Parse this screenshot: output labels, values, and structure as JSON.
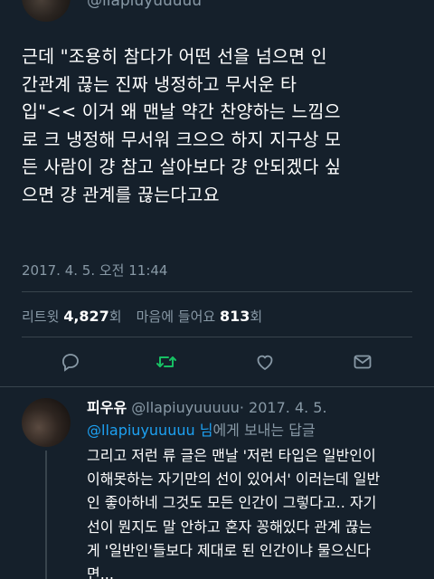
{
  "header": {
    "handle": "@llapiuyuuuuu"
  },
  "tweet": {
    "lines": [
      "근데 \"조용히 참다가 어떤 선을 넘으면 인",
      "간관계 끊는 진짜 냉정하고 무서운 타",
      "입\"<< 이거 왜 맨날 약간 찬양하는 느낌으",
      "로 크 냉정해 무서워 크으으 하지 지구상 모",
      "든 사람이 걍 참고 살아보다 걍 안되겠다 싶",
      "으면 걍 관계를 끊는다고요"
    ],
    "timestamp": "2017. 4. 5. 오전 11:44",
    "stats": {
      "retweet_label": "리트윗",
      "retweet_count": "4,827",
      "retweet_unit": "회",
      "like_label": "마음에 들어요",
      "like_count": "813",
      "like_unit": "회"
    }
  },
  "actions": {
    "reply_icon": "reply-icon",
    "retweet_icon": "retweet-icon",
    "like_icon": "heart-icon",
    "dm_icon": "envelope-icon",
    "retweet_color": "#17bf63",
    "icon_color": "#8899a6"
  },
  "reply": {
    "name": "피우유",
    "handle": "@llapiuyuuuuu",
    "date": "· 2017. 4. 5.",
    "mention": "@llapiuyuuuuu",
    "reply_to_suffix_1": "님",
    "reply_to_suffix_2": "에게 보내는 답글",
    "lines": [
      "그리고 저런 류 글은 맨날 '저런 타입은 일반인이",
      "이해못하는 자기만의 선이 있어서' 이러는데 일반",
      "인 좋아하네 그것도 모든 인간이 그렇다고.. 자기",
      "선이 뭔지도 말 안하고 혼자 꽁해있다 관계 끊는",
      "게 '일반인'들보다 제대로 된 인간이냐 물으신다",
      "면..."
    ]
  }
}
